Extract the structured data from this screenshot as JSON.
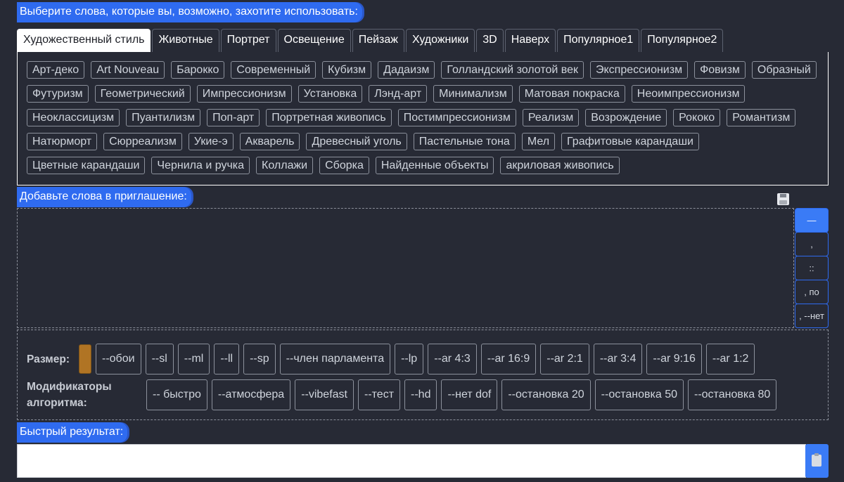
{
  "header": {
    "choose_words": "Выберите слова, которые вы, возможно, захотите использовать:"
  },
  "tabs": [
    "Художественный стиль",
    "Животные",
    "Портрет",
    "Освещение",
    "Пейзаж",
    "Художники",
    "3D",
    "Наверх",
    "Популярное1",
    "Популярное2"
  ],
  "active_tab": 0,
  "words": [
    "Арт-деко",
    "Art Nouveau",
    "Барокко",
    "Современный",
    "Кубизм",
    "Дадаизм",
    "Голландский золотой век",
    "Экспрессионизм",
    "Фовизм",
    "Образный",
    "Футуризм",
    "Геометрический",
    "Импрессионизм",
    "Установка",
    "Лэнд-арт",
    "Минимализм",
    "Матовая покраска",
    "Неоимпрессионизм",
    "Неоклассицизм",
    "Пуантилизм",
    "Поп-арт",
    "Портретная живопись",
    "Постимпрессионизм",
    "Реализм",
    "Возрождение",
    "Рококо",
    "Романтизм",
    "Натюрморт",
    "Сюрреализм",
    "Укие-э",
    "Акварель",
    "Древесный уголь",
    "Пастельные тона",
    "Мел",
    "Графитовые карандаши",
    "Цветные карандаши",
    "Чернила и ручка",
    "Коллажи",
    "Сборка",
    "Найденные объекты",
    "акриловая живопись"
  ],
  "prompt": {
    "label": "Добавьте слова в приглашение:",
    "value": "",
    "buttons": [
      "—",
      ",",
      "::",
      ", по",
      ", --нет"
    ]
  },
  "modifiers": {
    "size_label": "Размер:",
    "size_color": "#b07424",
    "size_options": [
      "--обои",
      "--sl",
      "--ml",
      "--ll",
      "--sp",
      "--член парламента",
      "--lp",
      "--ar 4:3",
      "--ar 16:9",
      "--ar 2:1",
      "--ar 3:4",
      "--ar 9:16",
      "--ar 1:2"
    ],
    "algo_label_1": "Модификаторы",
    "algo_label_2": "алгоритма:",
    "algo_options": [
      "-- быстро",
      "--атмосфера",
      "--vibefast",
      "--тест",
      "--hd",
      "--нет dof",
      "--остановка 20",
      "--остановка 50",
      "--остановка 80"
    ]
  },
  "quick": {
    "label": "Быстрый результат:",
    "value": ""
  },
  "icons": {
    "save": "save-icon",
    "copy": "clipboard-icon"
  }
}
